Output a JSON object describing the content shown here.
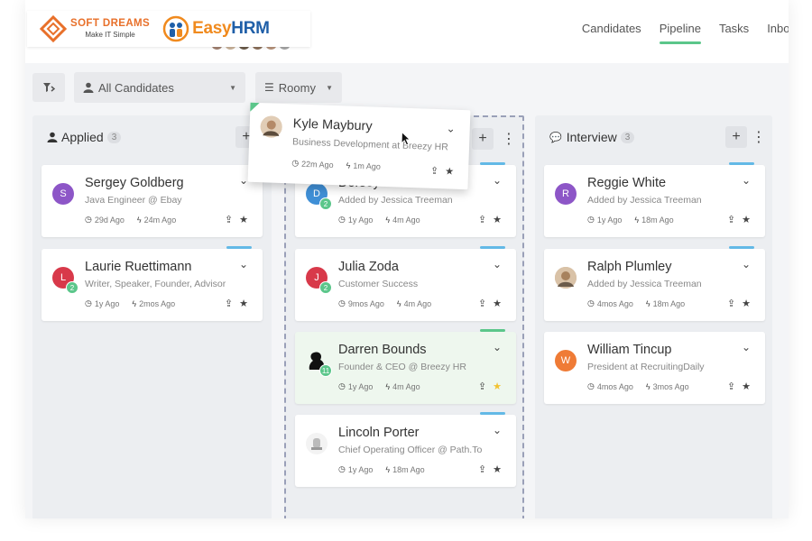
{
  "brand": {
    "softdreams_name": "SOFT DREAMS",
    "softdreams_tagline": "Make IT Simple",
    "easyhrm_a": "Easy",
    "easyhrm_b": "HRM"
  },
  "nav": {
    "tabs": [
      "Candidates",
      "Pipeline",
      "Tasks",
      "Inbox"
    ],
    "active": "Pipeline"
  },
  "toolbar": {
    "candidates_filter": "All Candidates",
    "view_filter": "Roomy"
  },
  "colors": {
    "accent_green": "#5bc68a",
    "tag_blue": "#63b9e6",
    "avatar_purple": "#8d56c7",
    "avatar_red": "#d8394a",
    "avatar_orange": "#ef7b36",
    "avatar_blue": "#3f8fd6"
  },
  "columns": [
    {
      "title": "Applied",
      "count": "3",
      "cards": [
        {
          "initial": "S",
          "name": "Sergey Goldberg",
          "sub": "Java Engineer @ Ebay",
          "created": "29d Ago",
          "updated": "24m Ago"
        },
        {
          "initial": "L",
          "name": "Laurie Ruettimann",
          "badge": "2",
          "sub": "Writer, Speaker, Founder, Advisor",
          "created": "1y Ago",
          "updated": "2mos Ago"
        }
      ]
    },
    {
      "cards": [
        {
          "initial": "D",
          "badge": "2",
          "name": "Dorsey Davis",
          "sub": "Added by Jessica Treeman",
          "created": "1y Ago",
          "updated": "4m Ago"
        },
        {
          "initial": "J",
          "badge": "2",
          "name": "Julia Zoda",
          "sub": "Customer Success",
          "created": "9mos Ago",
          "updated": "4m Ago"
        },
        {
          "badge": "11",
          "name": "Darren Bounds",
          "sub": "Founder & CEO @ Breezy HR",
          "created": "1y Ago",
          "updated": "4m Ago"
        },
        {
          "name": "Lincoln Porter",
          "sub": "Chief Operating Officer @ Path.To",
          "created": "1y Ago",
          "updated": "18m Ago"
        }
      ]
    },
    {
      "title": "Interview",
      "count": "3",
      "cards": [
        {
          "initial": "R",
          "name": "Reggie White",
          "sub": "Added by Jessica Treeman",
          "created": "1y Ago",
          "updated": "18m Ago"
        },
        {
          "name": "Ralph Plumley",
          "sub": "Added by Jessica Treeman",
          "created": "4mos Ago",
          "updated": "18m Ago"
        },
        {
          "initial": "W",
          "name": "William Tincup",
          "sub": "President at RecruitingDaily",
          "created": "4mos Ago",
          "updated": "3mos Ago"
        }
      ]
    }
  ],
  "dragging": {
    "name": "Kyle Maybury",
    "sub": "Business Development at Breezy HR",
    "created": "22m Ago",
    "updated": "1m Ago"
  },
  "icons": {
    "clock": "clock-icon",
    "bolt": "bolt-icon",
    "share": "share-icon",
    "star": "star-icon",
    "chevron": "chevron-down-icon",
    "plus": "plus-icon",
    "more": "more-vertical-icon",
    "user": "user-icon",
    "chat": "chat-icon",
    "filter": "filter-icon",
    "list": "list-icon"
  }
}
